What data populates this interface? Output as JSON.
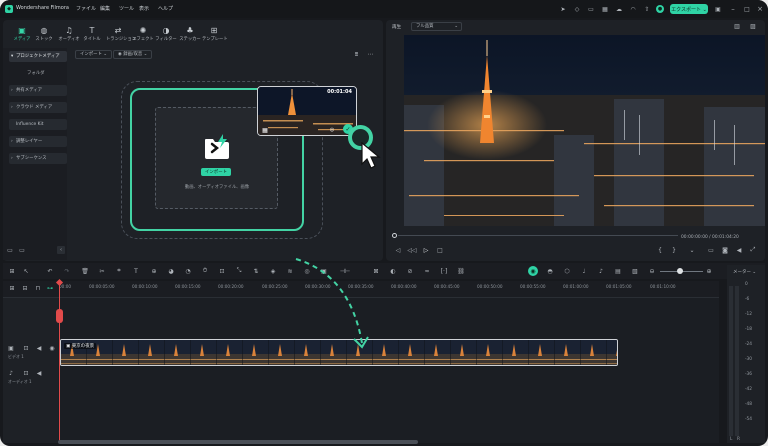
{
  "app": {
    "title": "Wondershare Filmora",
    "menu": [
      "ファイル",
      "編集",
      "ツール",
      "表示",
      "ヘルプ"
    ],
    "export_label": "エクスポート ⌄",
    "accent": "#2fd3a5"
  },
  "media": {
    "tabs": [
      {
        "label": "メディア",
        "icon": "media-icon"
      },
      {
        "label": "ストック",
        "icon": "stock-icon"
      },
      {
        "label": "オーディオ",
        "icon": "audio-icon"
      },
      {
        "label": "タイトル",
        "icon": "title-icon"
      },
      {
        "label": "トランジション",
        "icon": "transition-icon"
      },
      {
        "label": "エフェクト",
        "icon": "effect-icon"
      },
      {
        "label": "フィルター",
        "icon": "filter-icon"
      },
      {
        "label": "ステッカー",
        "icon": "sticker-icon"
      },
      {
        "label": "テンプレート",
        "icon": "template-icon"
      }
    ],
    "sidebar": {
      "project_media": "プロジェクトメディア",
      "folder": "フォルダ",
      "items": [
        "共有メディア",
        "クラウド メディア",
        "Influence Kit",
        "調整レイヤー",
        "サブシーケンス"
      ]
    },
    "import_dropdown": "インポート ⌄",
    "record_dropdown": "録画/収音 ⌄",
    "import_button": "インポート",
    "drop_hint": "動画、オーディオファイル、画像",
    "thumb_duration": "00:01:04"
  },
  "preview": {
    "label": "再生",
    "quality": "フル品質",
    "time": "00:00:00:00 / 00:01:04:20"
  },
  "timeline": {
    "ruler": [
      "00:00",
      "00:00:05:00",
      "00:00:10:00",
      "00:00:15:00",
      "00:00:20:00",
      "00:00:25:00",
      "00:00:30:00",
      "00:00:35:00",
      "00:00:40:00",
      "00:00:45:00",
      "00:00:50:00",
      "00:00:55:00",
      "00:01:00:00",
      "00:01:05:00",
      "00:01:10:00"
    ],
    "video_track": "ビデオ 1",
    "audio_track": "オーディオ 1",
    "clip_name": "東京の夜景"
  },
  "meter": {
    "title": "メーター ⌄",
    "scale": [
      "0",
      "-6",
      "-12",
      "-18",
      "-24",
      "-30",
      "-36",
      "-42",
      "-48",
      "-54"
    ],
    "lr": [
      "L",
      "R"
    ]
  }
}
